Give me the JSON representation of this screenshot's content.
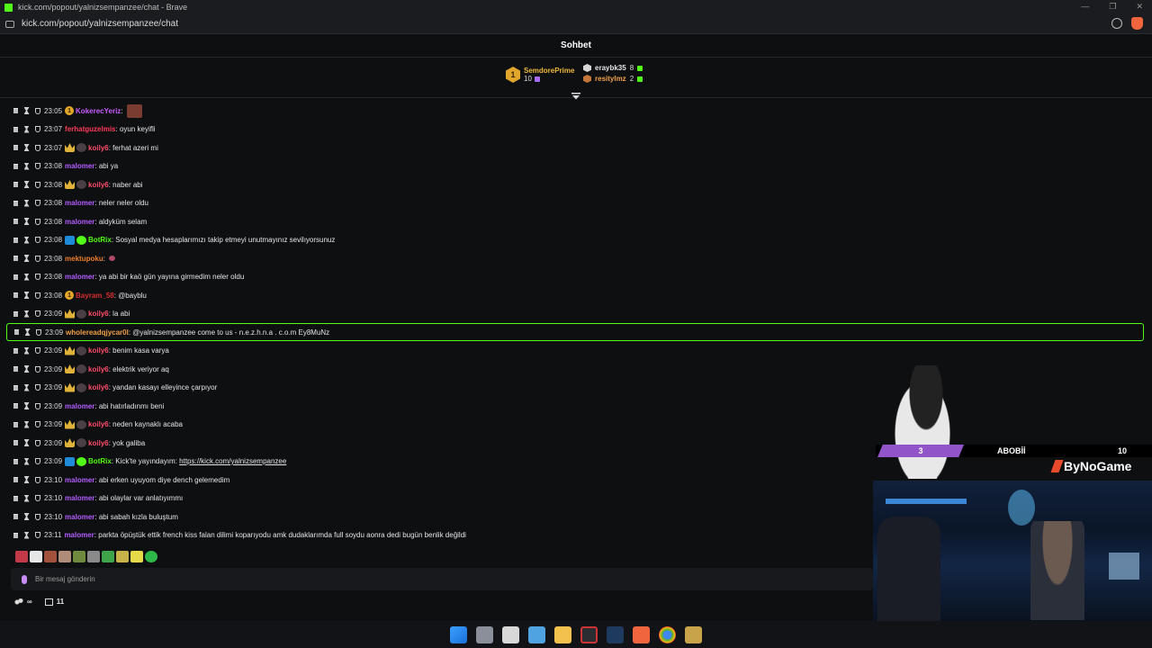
{
  "window": {
    "title": "kick.com/popout/yalnizsempanzee/chat - Brave",
    "url": "kick.com/popout/yalnizsempanzee/chat"
  },
  "chat": {
    "title": "Sohbet"
  },
  "leaderboard": {
    "first": {
      "rank": "1",
      "name": "SemdorePrime",
      "count": "10"
    },
    "others": [
      {
        "name": "eraybk35",
        "count": "8",
        "color": "#e6e6e6"
      },
      {
        "name": "resityImz",
        "count": "2",
        "color": "#f0a04a"
      }
    ]
  },
  "messages": [
    {
      "time": "23:05",
      "badges": [
        "num"
      ],
      "badge_num": "1",
      "user": "KokerecYeriz",
      "color": "#c85dff",
      "text": "",
      "emote": true
    },
    {
      "time": "23:07",
      "badges": [],
      "user": "ferhatguzelmis",
      "color": "#ff3c5a",
      "text": "oyun keyifli"
    },
    {
      "time": "23:07",
      "badges": [
        "sub",
        "kh"
      ],
      "user": "koily6",
      "color": "#ff4c6a",
      "text": "ferhat azeri mi"
    },
    {
      "time": "23:08",
      "badges": [],
      "user": "malomer",
      "color": "#b25dff",
      "text": "abi ya"
    },
    {
      "time": "23:08",
      "badges": [
        "sub",
        "kh"
      ],
      "user": "koily6",
      "color": "#ff4c6a",
      "text": "naber abi"
    },
    {
      "time": "23:08",
      "badges": [],
      "user": "malomer",
      "color": "#b25dff",
      "text": "neler neler oldu"
    },
    {
      "time": "23:08",
      "badges": [],
      "user": "malomer",
      "color": "#b25dff",
      "text": "aldyküm selam"
    },
    {
      "time": "23:08",
      "badges": [
        "bot",
        "ver"
      ],
      "user": "BotRix",
      "color": "#53fc18",
      "text": "Sosyal medya hesaplarımızı takip etmeyi unutmayınız sevilıyorsunuz"
    },
    {
      "time": "23:08",
      "badges": [],
      "user": "mektupoku",
      "color": "#f07f2c",
      "text": "",
      "small_emote": true
    },
    {
      "time": "23:08",
      "badges": [],
      "user": "malomer",
      "color": "#b25dff",
      "text": "ya abi bir kaö gün yayına girmedim neler oldu"
    },
    {
      "time": "23:08",
      "badges": [
        "num"
      ],
      "badge_num": "1",
      "user": "Bayram_58",
      "color": "#d42e2e",
      "text": "@bayblu"
    },
    {
      "time": "23:09",
      "badges": [
        "sub",
        "kh"
      ],
      "user": "koily6",
      "color": "#ff4c6a",
      "text": "la abi"
    },
    {
      "time": "23:09",
      "badges": [],
      "user": "wholereadqjycar0l",
      "color": "#f0a04a",
      "text": "@yalnizsempanzee come to us - n.e.z.h.n.a . c.o.m Ey8MuNz",
      "highlight": true
    },
    {
      "time": "23:09",
      "badges": [
        "sub",
        "kh"
      ],
      "user": "koily6",
      "color": "#ff4c6a",
      "text": "benim kasa varya"
    },
    {
      "time": "23:09",
      "badges": [
        "sub",
        "kh"
      ],
      "user": "koily6",
      "color": "#ff4c6a",
      "text": "elektrik veriyor aq"
    },
    {
      "time": "23:09",
      "badges": [
        "sub",
        "kh"
      ],
      "user": "koily6",
      "color": "#ff4c6a",
      "text": "yandan kasayı elleyince çarpıyor"
    },
    {
      "time": "23:09",
      "badges": [],
      "user": "malomer",
      "color": "#b25dff",
      "text": "abi hatırladınmı beni"
    },
    {
      "time": "23:09",
      "badges": [
        "sub",
        "kh"
      ],
      "user": "koily6",
      "color": "#ff4c6a",
      "text": "neden kaynaklı acaba"
    },
    {
      "time": "23:09",
      "badges": [
        "sub",
        "kh"
      ],
      "user": "koily6",
      "color": "#ff4c6a",
      "text": "yok galiba"
    },
    {
      "time": "23:09",
      "badges": [
        "bot",
        "ver"
      ],
      "user": "BotRix",
      "color": "#53fc18",
      "text": "Kick'te yayındayım: ",
      "link": "https://kick.com/yalnizsempanzee"
    },
    {
      "time": "23:10",
      "badges": [],
      "user": "malomer",
      "color": "#b25dff",
      "text": "abi erken uyuyom diye dench gelemedim"
    },
    {
      "time": "23:10",
      "badges": [],
      "user": "malomer",
      "color": "#b25dff",
      "text": "abi olaylar var anlatıyımmı"
    },
    {
      "time": "23:10",
      "badges": [],
      "user": "malomer",
      "color": "#b25dff",
      "text": "abi sabah kızla buluştum"
    },
    {
      "time": "23:11",
      "badges": [],
      "user": "malomer",
      "color": "#b25dff",
      "text": "parkta öpüştük ettik french kiss falan dilimi koparıyodu amk dudaklarımda full soydu aonra dedi bugün benlik değildi"
    }
  ],
  "composer": {
    "placeholder": "Bir mesaj gönderin"
  },
  "bottombar": {
    "points": "∞",
    "gifts": "11"
  },
  "overlay": {
    "score_left": "3",
    "team": "ABOBİİ",
    "score_right": "10",
    "brand": "ByNoGame"
  },
  "colors": {
    "accent": "#53fc18",
    "background": "#0e0f11"
  }
}
